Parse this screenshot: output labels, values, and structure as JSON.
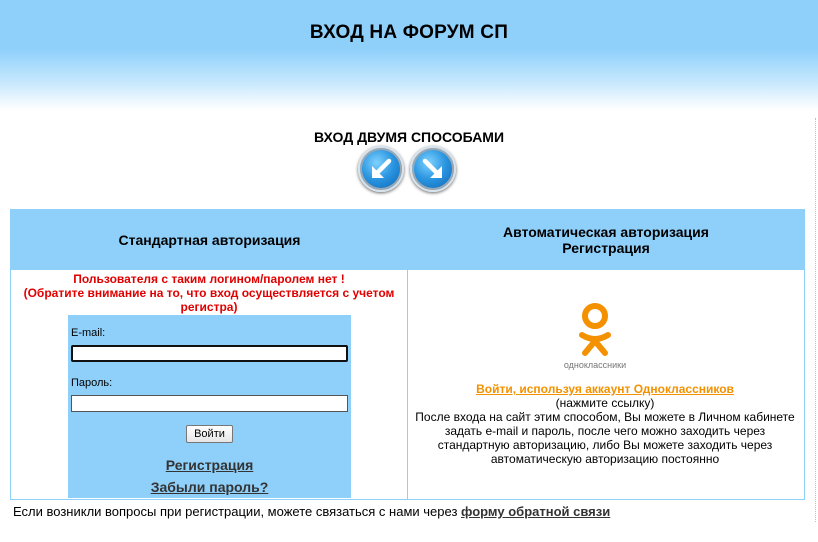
{
  "header": {
    "title": "ВХОД НА ФОРУМ СП"
  },
  "subtitle": "ВХОД ДВУМЯ СПОСОБАМИ",
  "icons": {
    "arrow_left": "arrow-down-left-icon",
    "arrow_right": "arrow-down-right-icon",
    "ok_logo": "odnoklassniki-logo"
  },
  "colors": {
    "header_blue": "#8fd0fb",
    "error_red": "#e00000",
    "ok_orange": "#f39100"
  },
  "columns": {
    "left_title": "Стандартная авторизация",
    "right_title_line1": "Автоматическая авторизация",
    "right_title_line2": "Регистрация"
  },
  "error": {
    "line1": "Пользователя с таким логином/паролем нет !",
    "line2": "(Обратите внимание на то, что вход осуществляется с учетом",
    "line3": "регистра)"
  },
  "form": {
    "email_label": "E-mail:",
    "email_value": "",
    "password_label": "Пароль:",
    "password_value": "",
    "login_button": "Войти",
    "register_link": "Регистрация",
    "forgot_link": "Забыли пароль?"
  },
  "ok": {
    "logo_text": "одноклассники",
    "link": "Войти, используя аккаунт Одноклассников",
    "hint": "(нажмите ссылку)",
    "description": "После входа на сайт этим способом, Вы можете в Личном кабинете задать e-mail и пароль, после чего можно заходить через стандартную авторизацию, либо Вы можете заходить через автоматическую авторизацию постоянно"
  },
  "footer": {
    "text": "Если возникли вопросы при регистрации, можете связаться с нами через ",
    "link": "форму обратной связи"
  }
}
